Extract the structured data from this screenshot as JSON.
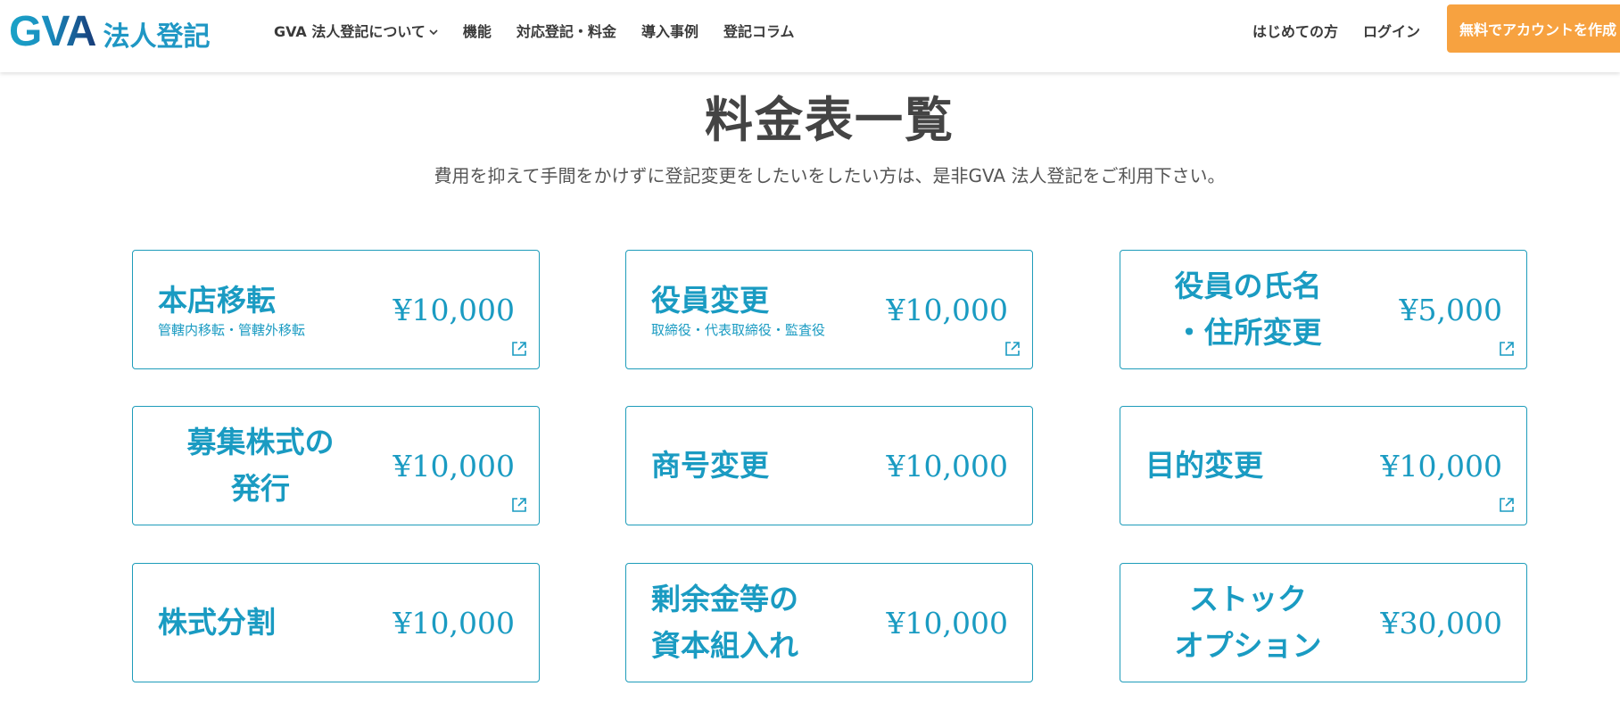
{
  "header": {
    "logo_mark": "GVA",
    "logo_sub": "法人登記",
    "nav": [
      {
        "label": "GVA 法人登記について",
        "has_dropdown": true
      },
      {
        "label": "機能"
      },
      {
        "label": "対応登記・料金"
      },
      {
        "label": "導入事例"
      },
      {
        "label": "登記コラム"
      }
    ],
    "right_nav": [
      {
        "label": "はじめての方"
      },
      {
        "label": "ログイン"
      }
    ],
    "cta_label": "無料でアカウントを作成"
  },
  "main": {
    "title": "料金表一覧",
    "description": "費用を抑えて手間をかけずに登記変更をしたいをしたい方は、是非GVA 法人登記をご利用下さい。"
  },
  "cards": [
    {
      "title": "本店移転",
      "subtitle": "管轄内移転・管轄外移転",
      "price": "¥10,000",
      "external_link": true
    },
    {
      "title": "役員変更",
      "subtitle": "取締役・代表取締役・監査役",
      "price": "¥10,000",
      "external_link": true
    },
    {
      "title": "役員の氏名\n・住所変更",
      "subtitle": "",
      "price": "¥5,000",
      "external_link": true
    },
    {
      "title": "募集株式の\n発行",
      "subtitle": "",
      "price": "¥10,000",
      "external_link": true
    },
    {
      "title": "商号変更",
      "subtitle": "",
      "price": "¥10,000",
      "external_link": false
    },
    {
      "title": "目的変更",
      "subtitle": "",
      "price": "¥10,000",
      "external_link": true
    },
    {
      "title": "株式分割",
      "subtitle": "",
      "price": "¥10,000",
      "external_link": false
    },
    {
      "title": "剰余金等の\n資本組入れ",
      "subtitle": "",
      "price": "¥10,000",
      "external_link": false
    },
    {
      "title": "ストック\nオプション",
      "subtitle": "",
      "price": "¥30,000",
      "external_link": false
    }
  ],
  "colors": {
    "accent": "#1a9bc2",
    "cta": "#f7a240",
    "text": "#444444"
  }
}
